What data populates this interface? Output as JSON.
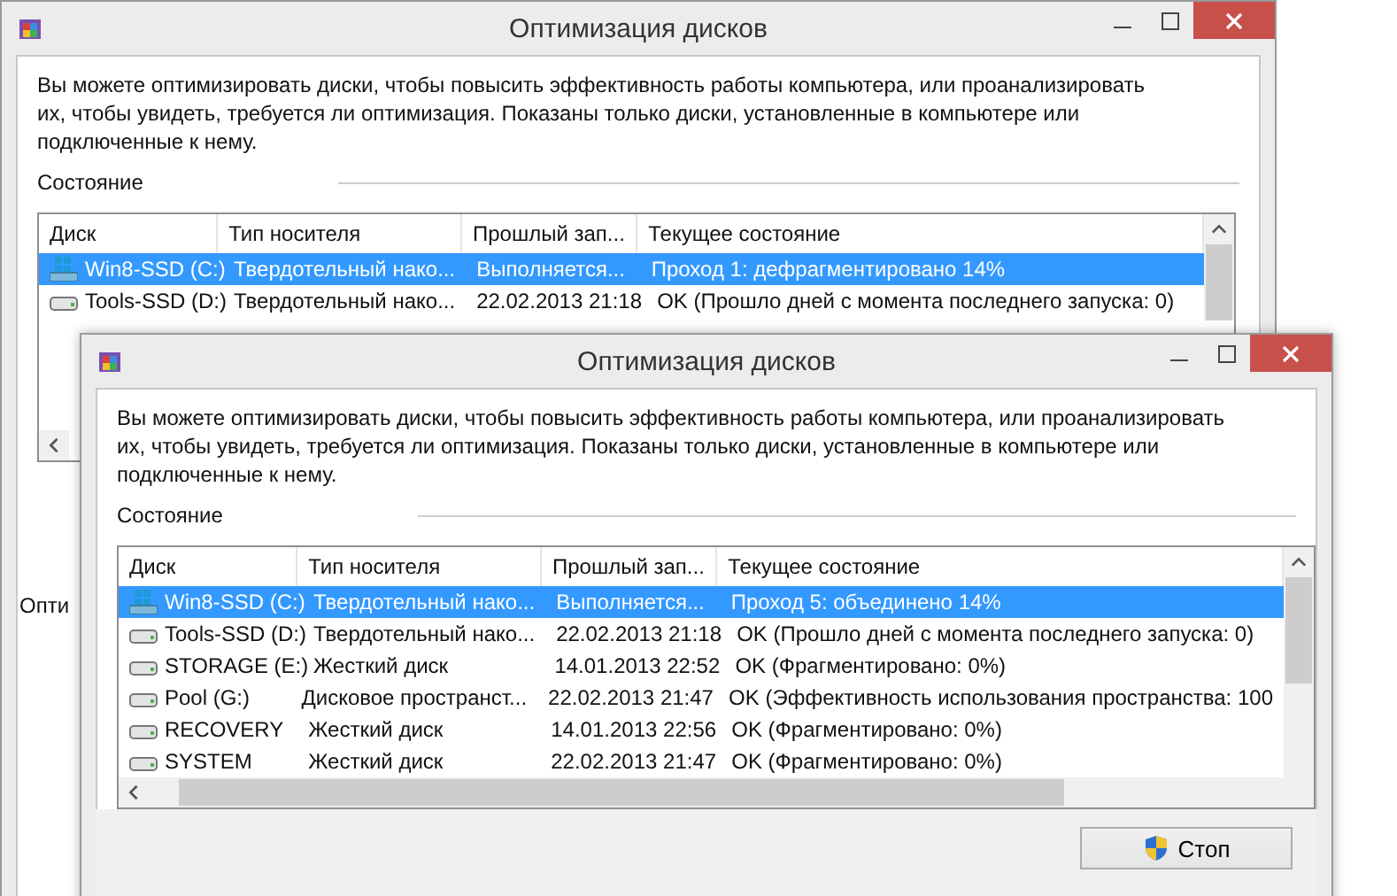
{
  "back_window": {
    "title": "Оптимизация дисков",
    "description": "Вы можете оптимизировать диски, чтобы повысить эффективность работы  компьютера, или проанализировать их, чтобы увидеть, требуется ли оптимизация. Показаны только диски, установленные в компьютере или подключенные к нему.",
    "status_label": "Состояние",
    "columns": [
      "Диск",
      "Тип носителя",
      "Прошлый зап...",
      "Текущее состояние"
    ],
    "rows": [
      {
        "kind": "system",
        "name": "Win8-SSD (C:)",
        "media": "Твердотельный нако...",
        "last_run": "Выполняется...",
        "status": "Проход 1: дефрагментировано 14%",
        "selected": true
      },
      {
        "kind": "drive",
        "name": "Tools-SSD (D:)",
        "media": "Твердотельный нако...",
        "last_run": "22.02.2013 21:18",
        "status": "OK (Прошло дней с момента последнего запуска: 0)",
        "selected": false
      }
    ],
    "section_label": "Опти"
  },
  "front_window": {
    "title": "Оптимизация дисков",
    "description": "Вы можете оптимизировать диски, чтобы повысить эффективность работы  компьютера, или проанализировать их, чтобы увидеть, требуется ли оптимизация. Показаны только диски, установленные в компьютере или подключенные к нему.",
    "status_label": "Состояние",
    "columns": [
      "Диск",
      "Тип носителя",
      "Прошлый зап...",
      "Текущее состояние"
    ],
    "rows": [
      {
        "kind": "system",
        "name": "Win8-SSD (C:)",
        "media": "Твердотельный нако...",
        "last_run": "Выполняется...",
        "status": "Проход 5: объединено 14%",
        "selected": true
      },
      {
        "kind": "drive",
        "name": "Tools-SSD (D:)",
        "media": "Твердотельный нако...",
        "last_run": "22.02.2013 21:18",
        "status": "OK (Прошло дней с момента последнего запуска: 0)",
        "selected": false
      },
      {
        "kind": "drive",
        "name": "STORAGE (E:)",
        "media": "Жесткий диск",
        "last_run": "14.01.2013 22:52",
        "status": "OK (Фрагментировано: 0%)",
        "selected": false
      },
      {
        "kind": "drive",
        "name": "Pool (G:)",
        "media": "Дисковое пространст...",
        "last_run": "22.02.2013 21:47",
        "status": "OK (Эффективность использования пространства: 100",
        "selected": false
      },
      {
        "kind": "drive",
        "name": "RECOVERY",
        "media": "Жесткий диск",
        "last_run": "14.01.2013 22:56",
        "status": "OK (Фрагментировано: 0%)",
        "selected": false
      },
      {
        "kind": "drive",
        "name": "SYSTEM",
        "media": "Жесткий диск",
        "last_run": "22.02.2013 21:47",
        "status": "OK (Фрагментировано: 0%)",
        "selected": false
      }
    ],
    "button": "Стоп"
  }
}
